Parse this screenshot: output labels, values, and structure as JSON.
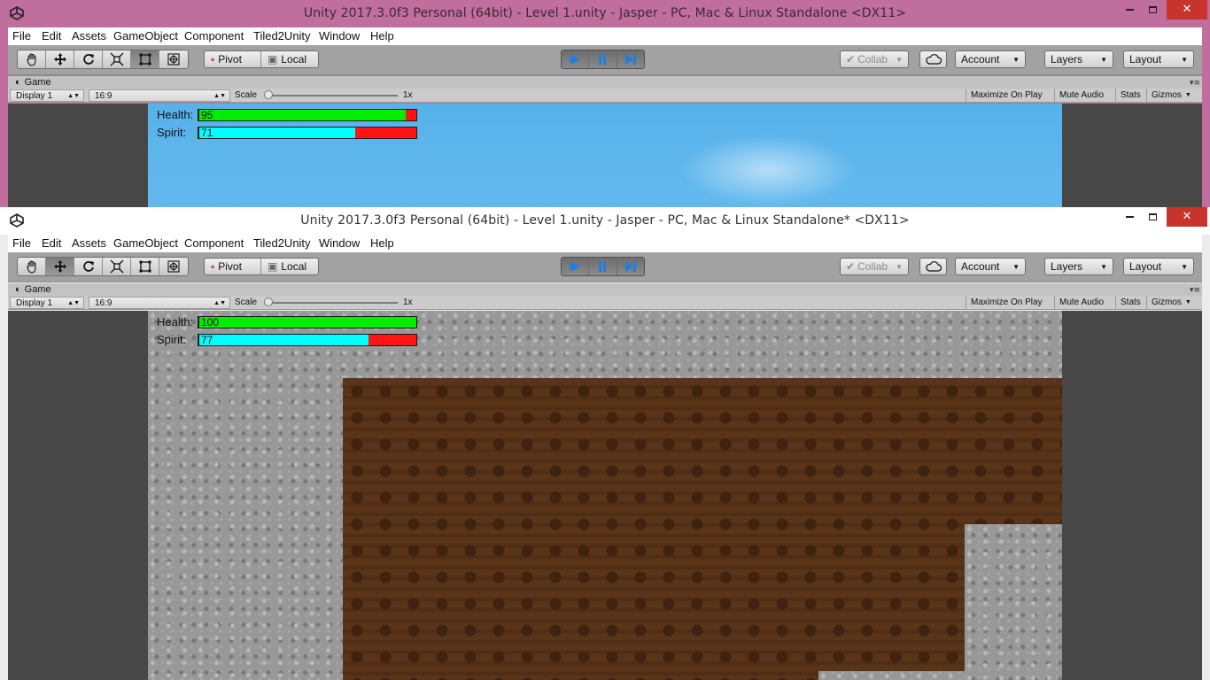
{
  "windows": {
    "back": {
      "title": "Unity 2017.3.0f3 Personal (64bit) - Level 1.unity - Jasper - PC, Mac & Linux Standalone <DX11>",
      "hud": {
        "health_label": "Health:",
        "health_value": "95",
        "health_fraction": 0.95,
        "spirit_label": "Spirit:",
        "spirit_value": "71",
        "spirit_fraction": 0.72
      }
    },
    "front": {
      "title": "Unity 2017.3.0f3 Personal (64bit) - Level 1.unity - Jasper - PC, Mac & Linux Standalone* <DX11>",
      "hud": {
        "health_label": "Health:",
        "health_value": "100",
        "health_fraction": 1.0,
        "spirit_label": "Spirit:",
        "spirit_value": "77",
        "spirit_fraction": 0.78
      }
    }
  },
  "menu": [
    "File",
    "Edit",
    "Assets",
    "GameObject",
    "Component",
    "Tiled2Unity",
    "Window",
    "Help"
  ],
  "toolbar": {
    "pivot_label": "Pivot",
    "local_label": "Local",
    "collab_label": "Collab",
    "account_label": "Account",
    "layers_label": "Layers",
    "layout_label": "Layout"
  },
  "game_tab": {
    "tab_label": "Game",
    "display_label": "Display 1",
    "aspect_label": "16:9",
    "scale_label": "Scale",
    "scale_value": "1x",
    "maximize_label": "Maximize On Play",
    "mute_label": "Mute Audio",
    "stats_label": "Stats",
    "gizmos_label": "Gizmos"
  },
  "colors": {
    "health_fill": "#00ee00",
    "spirit_fill": "#00ffff",
    "bar_empty": "#ff1313",
    "back_window_frame": "#c06e9e",
    "play_accent": "#1f7fe0"
  },
  "icons": [
    "unity-logo-icon",
    "hand-tool-icon",
    "move-tool-icon",
    "rotate-tool-icon",
    "scale-tool-icon",
    "rect-tool-icon",
    "transform-tool-icon",
    "play-icon",
    "pause-icon",
    "step-icon",
    "cloud-icon",
    "game-tab-icon"
  ]
}
